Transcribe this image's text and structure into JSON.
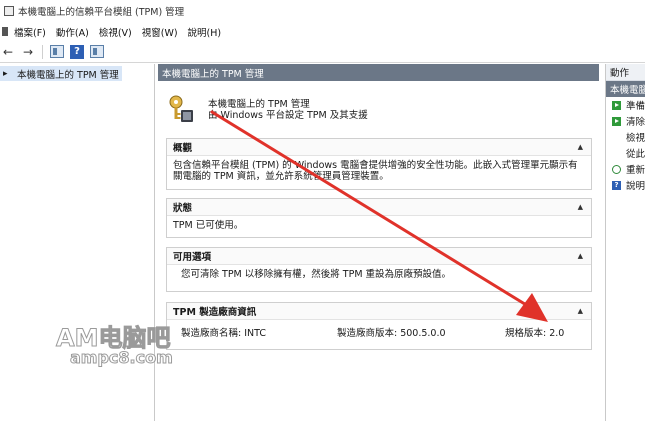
{
  "window": {
    "title": "本機電腦上的信賴平台模組 (TPM) 管理"
  },
  "menu": {
    "items": [
      "檔案(F)",
      "動作(A)",
      "檢視(V)",
      "視窗(W)",
      "說明(H)"
    ]
  },
  "toolbar": {
    "icons": [
      "back-arrow-icon",
      "forward-arrow-icon",
      "console-tree-icon",
      "help-icon",
      "panel-icon"
    ]
  },
  "tree": {
    "root_label": "本機電腦上的 TPM 管理"
  },
  "center": {
    "header": "本機電腦上的 TPM 管理",
    "intro_title": "本機電腦上的 TPM 管理",
    "intro_subtitle": "由 Windows 平台設定 TPM 及其支援",
    "overview": {
      "title": "概觀",
      "text": "包含信賴平台模組 (TPM) 的 Windows 電腦會提供增強的安全性功能。此嵌入式管理單元顯示有關電腦的 TPM 資訊，並允許系統管理員管理裝置。"
    },
    "status": {
      "title": "狀態",
      "text": "TPM 已可使用。"
    },
    "options": {
      "title": "可用選項",
      "text": "您可清除 TPM 以移除擁有權，然後將 TPM 重設為原廠預設值。"
    },
    "manufacturer": {
      "title": "TPM 製造廠商資訊",
      "name": "製造廠商名稱: INTC",
      "version": "製造廠商版本: 500.5.0.0",
      "spec": "規格版本: 2.0"
    }
  },
  "actions": {
    "header": "動作",
    "section": "本機電腦",
    "items": [
      "準備",
      "清除",
      "檢視",
      "從此",
      "重新",
      "說明"
    ]
  },
  "watermark": {
    "line1": "AM电脑吧",
    "line2": "ampc8.com"
  },
  "colors": {
    "header_bg": "#6b7787",
    "selected_bg": "#d8e6f7",
    "annotation_arrow": "#e0322a"
  }
}
